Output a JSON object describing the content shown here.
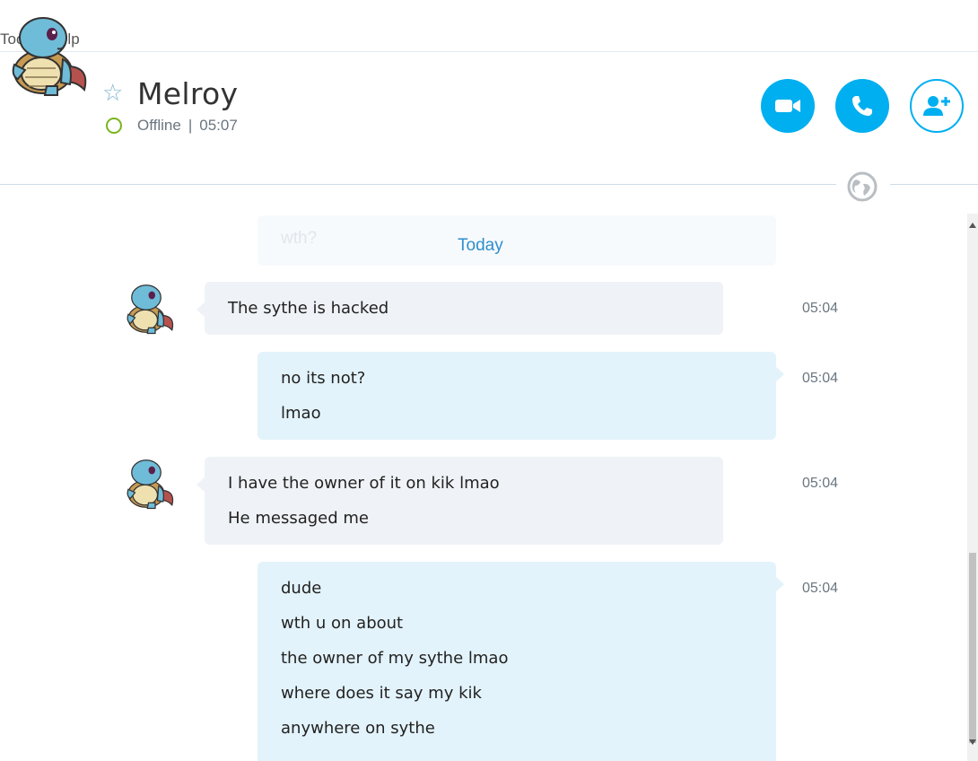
{
  "menu": {
    "items": [
      "Tools",
      "Help"
    ]
  },
  "contact": {
    "name": "Melroy",
    "status": "Offline",
    "local_time": "05:07",
    "status_separator": "|",
    "favorite_icon": "star-icon",
    "presence_color": "#7ab51d"
  },
  "actions": {
    "video_icon": "video-camera-icon",
    "call_icon": "phone-icon",
    "add_icon": "add-contact-icon",
    "accent": "#00aff0"
  },
  "conversation": {
    "ghost_text": "wth?",
    "date_label": "Today",
    "messages": [
      {
        "direction": "incoming",
        "time": "05:04",
        "lines": [
          "The sythe is hacked"
        ]
      },
      {
        "direction": "outgoing",
        "time": "05:04",
        "lines": [
          "no its not?",
          "lmao"
        ]
      },
      {
        "direction": "incoming",
        "time": "05:04",
        "lines": [
          "I have the owner of it on kik lmao",
          "He messaged me"
        ]
      },
      {
        "direction": "outgoing",
        "time": "05:04",
        "lines": [
          "dude",
          "wth u on about",
          "the owner of my sythe lmao",
          "where does it say my kik",
          "anywhere on sythe"
        ]
      }
    ]
  }
}
